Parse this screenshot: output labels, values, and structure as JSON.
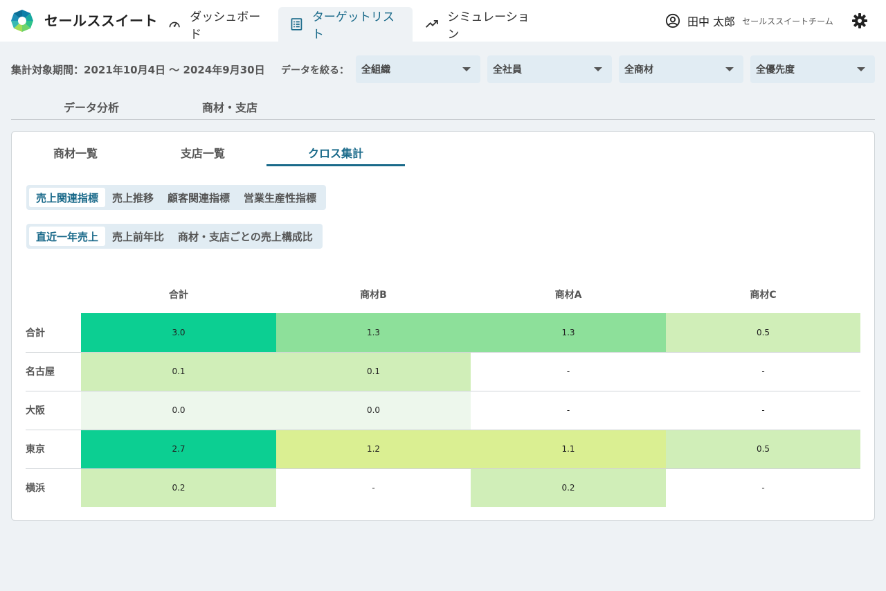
{
  "header": {
    "app_name": "セールススイート",
    "nav": [
      {
        "label": "ダッシュボード"
      },
      {
        "label": "ターゲットリスト"
      },
      {
        "label": "シミュレーション"
      }
    ],
    "user_name": "田中 太郎",
    "user_team": "セールススイートチーム"
  },
  "filters": {
    "period": "集計対象期間：2021年10月4日 〜 2024年9月30日",
    "label": "データを絞る：",
    "selects": [
      "全組織",
      "全社員",
      "全商材",
      "全優先度"
    ]
  },
  "section_tabs": [
    "データ分析",
    "商材・支店"
  ],
  "inner_tabs": [
    "商材一覧",
    "支店一覧",
    "クロス集計"
  ],
  "metric_tabs": [
    "売上関連指標",
    "売上推移",
    "顧客関連指標",
    "営業生産性指標"
  ],
  "sub_tabs": [
    "直近一年売上",
    "売上前年比",
    "商材・支店ごとの売上構成比"
  ],
  "table": {
    "columns": [
      "合計",
      "商材B",
      "商材A",
      "商材C"
    ],
    "rows": [
      {
        "label": "合計",
        "cells": [
          "3.0",
          "1.3",
          "1.3",
          "0.5"
        ]
      },
      {
        "label": "名古屋",
        "cells": [
          "0.1",
          "0.1",
          "-",
          "-"
        ]
      },
      {
        "label": "大阪",
        "cells": [
          "0.0",
          "0.0",
          "-",
          "-"
        ]
      },
      {
        "label": "東京",
        "cells": [
          "2.7",
          "1.2",
          "1.1",
          "0.5"
        ]
      },
      {
        "label": "横浜",
        "cells": [
          "0.2",
          "-",
          "0.2",
          "-"
        ]
      }
    ]
  },
  "colors": {
    "accent": "#1a6a8a",
    "heat_strong": "#0ccf92",
    "heat_mid": "#8de09a",
    "heat_yellow": "#daef92",
    "heat_light": "#d0eeb8",
    "heat_faint": "#edf7ec"
  },
  "icons": {
    "logo": "logo-mark",
    "dashboard": "speedometer-icon",
    "target": "list-icon",
    "simulation": "trend-up-icon",
    "user": "user-circle-icon",
    "settings": "gear-icon"
  }
}
